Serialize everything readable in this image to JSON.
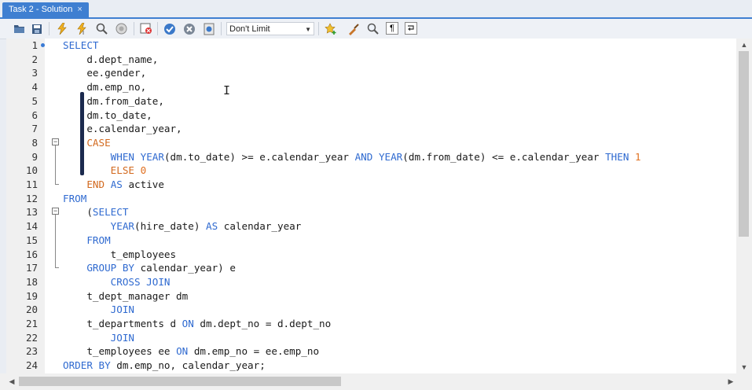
{
  "tab": {
    "title": "Task 2 - Solution",
    "close": "×"
  },
  "toolbar": {
    "limit_select": "Don't Limit",
    "icons": [
      "open-folder-icon",
      "save-icon",
      "execute-icon",
      "execute-current-icon",
      "explain-icon",
      "stop-icon",
      "toggle-error-icon",
      "commit-icon",
      "rollback-icon",
      "autocommit-icon",
      "bookmark-icon",
      "beautify-icon",
      "find-icon",
      "invisible-chars-icon",
      "wrap-icon"
    ]
  },
  "editor": {
    "lines": [
      {
        "n": "1",
        "parts": [
          [
            "kw",
            "SELECT"
          ]
        ]
      },
      {
        "n": "2",
        "parts": [
          [
            "t",
            "    d.dept_name,"
          ]
        ]
      },
      {
        "n": "3",
        "parts": [
          [
            "t",
            "    ee.gender,"
          ]
        ]
      },
      {
        "n": "4",
        "parts": [
          [
            "t",
            "    dm.emp_no,"
          ]
        ]
      },
      {
        "n": "5",
        "parts": [
          [
            "t",
            "    dm.from_date,"
          ]
        ]
      },
      {
        "n": "6",
        "parts": [
          [
            "t",
            "    dm.to_date,"
          ]
        ]
      },
      {
        "n": "7",
        "parts": [
          [
            "t",
            "    e.calendar_year,"
          ]
        ]
      },
      {
        "n": "8",
        "parts": [
          [
            "t",
            "    "
          ],
          [
            "kwo",
            "CASE"
          ]
        ]
      },
      {
        "n": "9",
        "parts": [
          [
            "t",
            "        "
          ],
          [
            "kw",
            "WHEN"
          ],
          [
            "t",
            " "
          ],
          [
            "kw",
            "YEAR"
          ],
          [
            "t",
            "(dm.to_date) >= e.calendar_year "
          ],
          [
            "kw",
            "AND"
          ],
          [
            "t",
            " "
          ],
          [
            "kw",
            "YEAR"
          ],
          [
            "t",
            "(dm.from_date) <= e.calendar_year "
          ],
          [
            "kw",
            "THEN"
          ],
          [
            "t",
            " "
          ],
          [
            "num",
            "1"
          ]
        ]
      },
      {
        "n": "10",
        "parts": [
          [
            "t",
            "        "
          ],
          [
            "kwo",
            "ELSE"
          ],
          [
            "t",
            " "
          ],
          [
            "num",
            "0"
          ]
        ]
      },
      {
        "n": "11",
        "parts": [
          [
            "t",
            "    "
          ],
          [
            "kwo",
            "END"
          ],
          [
            "t",
            " "
          ],
          [
            "kw",
            "AS"
          ],
          [
            "t",
            " active"
          ]
        ]
      },
      {
        "n": "12",
        "parts": [
          [
            "kw",
            "FROM"
          ]
        ]
      },
      {
        "n": "13",
        "parts": [
          [
            "t",
            "    ("
          ],
          [
            "kw",
            "SELECT"
          ]
        ]
      },
      {
        "n": "14",
        "parts": [
          [
            "t",
            "        "
          ],
          [
            "kw",
            "YEAR"
          ],
          [
            "t",
            "(hire_date) "
          ],
          [
            "kw",
            "AS"
          ],
          [
            "t",
            " calendar_year"
          ]
        ]
      },
      {
        "n": "15",
        "parts": [
          [
            "t",
            "    "
          ],
          [
            "kw",
            "FROM"
          ]
        ]
      },
      {
        "n": "16",
        "parts": [
          [
            "t",
            "        t_employees"
          ]
        ]
      },
      {
        "n": "17",
        "parts": [
          [
            "t",
            "    "
          ],
          [
            "kw",
            "GROUP BY"
          ],
          [
            "t",
            " calendar_year) e"
          ]
        ]
      },
      {
        "n": "18",
        "parts": [
          [
            "t",
            "        "
          ],
          [
            "kw",
            "CROSS JOIN"
          ]
        ]
      },
      {
        "n": "19",
        "parts": [
          [
            "t",
            "    t_dept_manager dm"
          ]
        ]
      },
      {
        "n": "20",
        "parts": [
          [
            "t",
            "        "
          ],
          [
            "kw",
            "JOIN"
          ]
        ]
      },
      {
        "n": "21",
        "parts": [
          [
            "t",
            "    t_departments d "
          ],
          [
            "kw",
            "ON"
          ],
          [
            "t",
            " dm.dept_no = d.dept_no"
          ]
        ]
      },
      {
        "n": "22",
        "parts": [
          [
            "t",
            "        "
          ],
          [
            "kw",
            "JOIN"
          ]
        ]
      },
      {
        "n": "23",
        "parts": [
          [
            "t",
            "    t_employees ee "
          ],
          [
            "kw",
            "ON"
          ],
          [
            "t",
            " dm.emp_no = ee.emp_no"
          ]
        ]
      },
      {
        "n": "24",
        "parts": [
          [
            "kw",
            "ORDER BY"
          ],
          [
            "t",
            " dm.emp_no, calendar_year;"
          ]
        ]
      }
    ]
  }
}
